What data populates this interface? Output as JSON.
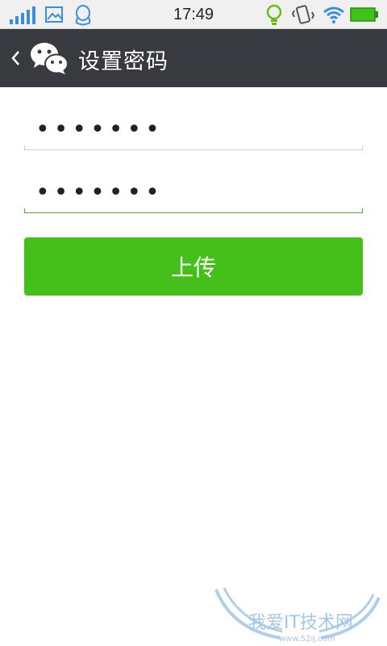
{
  "status_bar": {
    "time": "17:49",
    "icons": [
      "signal-icon",
      "image-icon",
      "qq-icon",
      "bulb-icon",
      "vibrate-icon",
      "wifi-icon",
      "battery-icon"
    ]
  },
  "header": {
    "title": "设置密码",
    "back_icon": "chevron-left-icon",
    "logo": "wechat-logo-icon",
    "background": "#393a3f"
  },
  "form": {
    "password_value": "•••••••",
    "confirm_password_value": "•••••••",
    "submit_label": "上传",
    "accent_color": "#45c01a"
  },
  "watermark": {
    "text": "我爱IT技术网",
    "subtext": "www.52ij.com"
  }
}
